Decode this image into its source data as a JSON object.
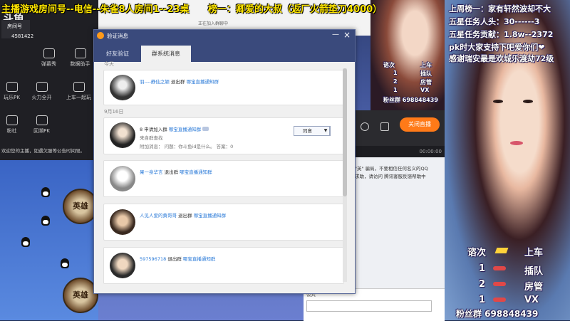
{
  "overlay": {
    "top_left": "主播游戏房间号--电信--朱雀8人房间1--23桌",
    "top_mid": "榜一：卿爱的大叔（返厂火箭垫刀4000）",
    "right_lines": [
      "上周榜一：家有轩然波却不大",
      "五星任务人头：30------3",
      "五星任务贡献：1.8w--2372",
      "pk时大家支持下吧爱你们❤",
      "感谢瑞安最是欢城乐渡劫72级"
    ],
    "small_box": {
      "l1": "1",
      "l2": "1",
      "l3": "2",
      "l4": "1",
      "prefix": "谘次",
      "s1": "上车",
      "s2": "插队",
      "s3": "房管",
      "s4": "VX",
      "fans": "粉丝群 698848439"
    },
    "big_box": {
      "prefix": "谘次",
      "s1": "上车",
      "s2": "插队",
      "s3": "房管",
      "s4": "VX",
      "n1": "1",
      "n2": "2",
      "n3": "1",
      "fans": "粉丝群 698848439"
    }
  },
  "left_panel": {
    "logo": "斗鱼",
    "room_label": "房间号",
    "room_number": "4581422",
    "items": [
      "弹幕秀",
      "数据助手",
      "火力全开",
      "上车一起玩",
      "回溯PK",
      "玩乐PK",
      "粉社"
    ],
    "note": "欢迎您的主播，如遇欠服等公告时间限。"
  },
  "qq_chat": {
    "notice": "正在加入群聊中",
    "live_button": "关闭直播",
    "time": "00:00:00",
    "warn_lines": [
      "\"英\" 骗局，不要相信任何名义的QQ",
      "求助，请访问 腾讯客服反馈帮助中"
    ],
    "input_label": "公共"
  },
  "dialog": {
    "title": "验证消息",
    "tabs": [
      "好友验证",
      "群系统消息"
    ],
    "sections": {
      "today": "今天",
      "date": "9月16日"
    },
    "messages": [
      {
        "name": "羽----静仙之颖",
        "action": "退出群",
        "group": "哪宝直播通知群"
      },
      {
        "name": "8",
        "action": "申请加入群",
        "group": "哪宝直播通知群",
        "source": "来自群查找",
        "extra": "附加消息：   问题：你斗鱼id是什么。  答案：0",
        "button": "同意"
      },
      {
        "name": "果一身华言",
        "action": "退出群",
        "group": "哪宝直播通知群"
      },
      {
        "name": "人见人爱的黄哥哥",
        "action": "退出群",
        "group": "哪宝直播通知群"
      },
      {
        "name": "597596718",
        "action": "退出群",
        "group": "哪宝直播通知群"
      }
    ]
  },
  "colors": {
    "dialog_header": "#3a4a7c",
    "link": "#2a7ad8",
    "live_button": "#ff7a18",
    "overlay_yellow": "#ffe600"
  }
}
